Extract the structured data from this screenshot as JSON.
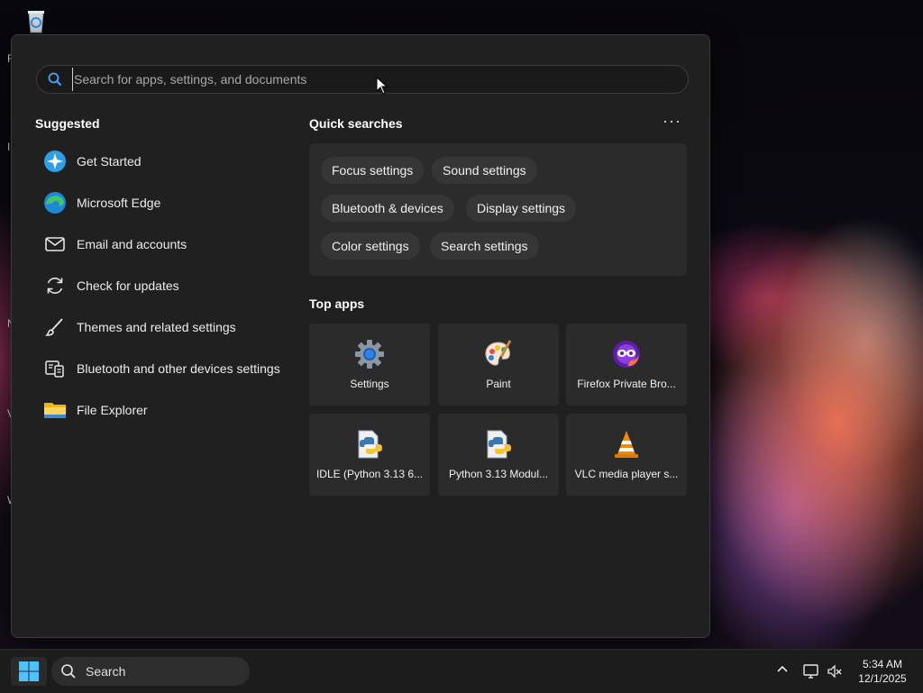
{
  "desktop": {
    "icon_letters": [
      "F",
      "I",
      "N",
      "V",
      "W"
    ]
  },
  "start_menu": {
    "search": {
      "placeholder": "Search for apps, settings, and documents",
      "value": ""
    },
    "suggested": {
      "title": "Suggested",
      "items": [
        {
          "label": "Get Started",
          "icon": "get-started-icon"
        },
        {
          "label": "Microsoft Edge",
          "icon": "edge-icon"
        },
        {
          "label": "Email and accounts",
          "icon": "mail-icon"
        },
        {
          "label": "Check for updates",
          "icon": "refresh-icon"
        },
        {
          "label": "Themes and related settings",
          "icon": "brush-icon"
        },
        {
          "label": "Bluetooth and other devices settings",
          "icon": "devices-icon"
        },
        {
          "label": "File Explorer",
          "icon": "folder-icon"
        }
      ]
    },
    "quick_searches": {
      "title": "Quick searches",
      "more": "···",
      "chips": [
        "Focus settings",
        "Sound settings",
        "Bluetooth & devices",
        "Display settings",
        "Color settings",
        "Search settings"
      ]
    },
    "top_apps": {
      "title": "Top apps",
      "apps": [
        {
          "label": "Settings",
          "icon": "settings-gear-icon"
        },
        {
          "label": "Paint",
          "icon": "paint-palette-icon"
        },
        {
          "label": "Firefox Private Bro...",
          "icon": "firefox-private-icon"
        },
        {
          "label": "IDLE (Python 3.13 6...",
          "icon": "python-file-icon"
        },
        {
          "label": "Python 3.13 Modul...",
          "icon": "python-file-icon"
        },
        {
          "label": "VLC media player s...",
          "icon": "vlc-cone-icon"
        }
      ]
    }
  },
  "taskbar": {
    "search_label": "Search",
    "time": "5:34 AM",
    "date": "12/1/2025"
  },
  "colors": {
    "menu_bg": "#202020",
    "panel_bg": "#2b2b2b",
    "chip_bg": "#363636",
    "accent": "#0078d4"
  }
}
